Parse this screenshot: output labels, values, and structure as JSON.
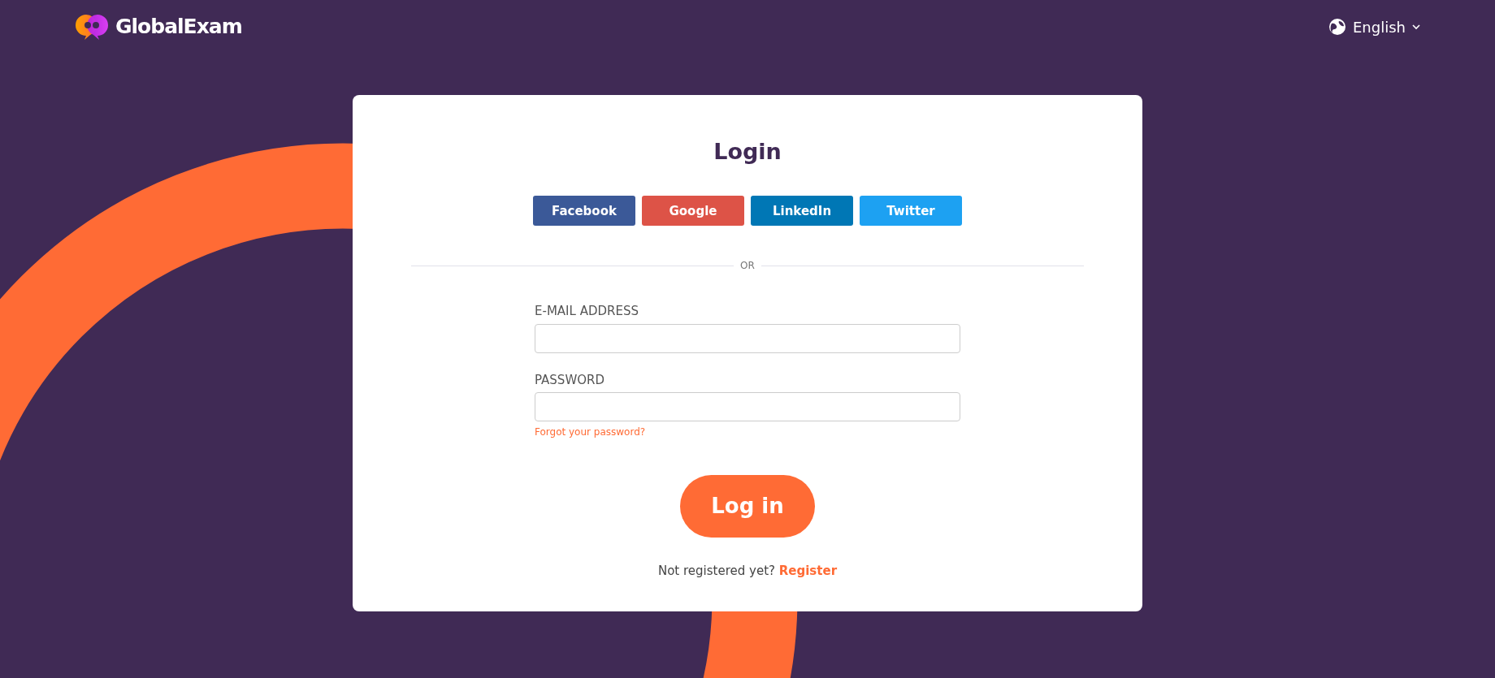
{
  "brand": {
    "name": "GlobalExam"
  },
  "language": {
    "label": "English"
  },
  "login": {
    "title": "Login",
    "social_buttons": [
      {
        "label": "Facebook",
        "color": "#3b5998"
      },
      {
        "label": "Google",
        "color": "#dd5347"
      },
      {
        "label": "LinkedIn",
        "color": "#0077b5"
      },
      {
        "label": "Twitter",
        "color": "#1da1f2"
      }
    ],
    "divider": "OR",
    "fields": [
      {
        "label": "E-MAIL ADDRESS"
      },
      {
        "label": "PASSWORD"
      }
    ],
    "forgot_link": "Forgot your password?",
    "submit": "Log in",
    "register_prompt": "Not registered yet?",
    "register_link": "Register"
  }
}
